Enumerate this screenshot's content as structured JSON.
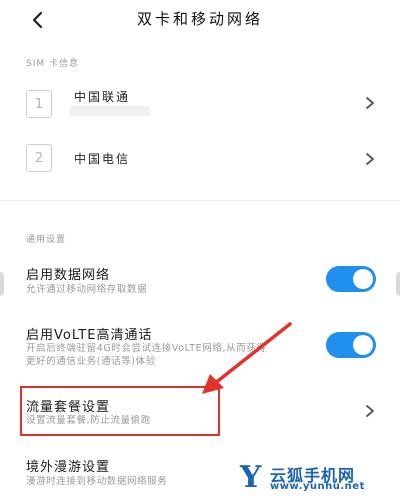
{
  "header": {
    "title": "双卡和移动网络"
  },
  "sim_section": {
    "label": "SIM 卡信息",
    "cards": [
      {
        "slot": "1",
        "carrier": "中国联通"
      },
      {
        "slot": "2",
        "carrier": "中国电信"
      }
    ]
  },
  "general_section": {
    "label": "通用设置",
    "mobile_data": {
      "title": "启用数据网络",
      "desc": "允许通过移动网络存取数据",
      "enabled": true
    },
    "volte": {
      "title": "启用VoLTE高清通话",
      "desc_line1": "开启后终端驻留4G时会尝试连接VoLTE网络,从而获得",
      "desc_line2": "更好的通信业务(通话等)体验",
      "enabled": true
    },
    "data_plan": {
      "title": "流量套餐设置",
      "desc": "设置流量套餐,防止流量偷跑"
    },
    "roaming": {
      "title": "境外漫游设置",
      "desc": "漫游时连接到移动数据网络服务"
    }
  },
  "colors": {
    "accent": "#1f8ff0",
    "annotation": "#e3322b",
    "watermark": "#1d63b3"
  },
  "watermark": {
    "logo": "Y",
    "name": "云狐手机网",
    "url": "www.yunhu.net"
  }
}
